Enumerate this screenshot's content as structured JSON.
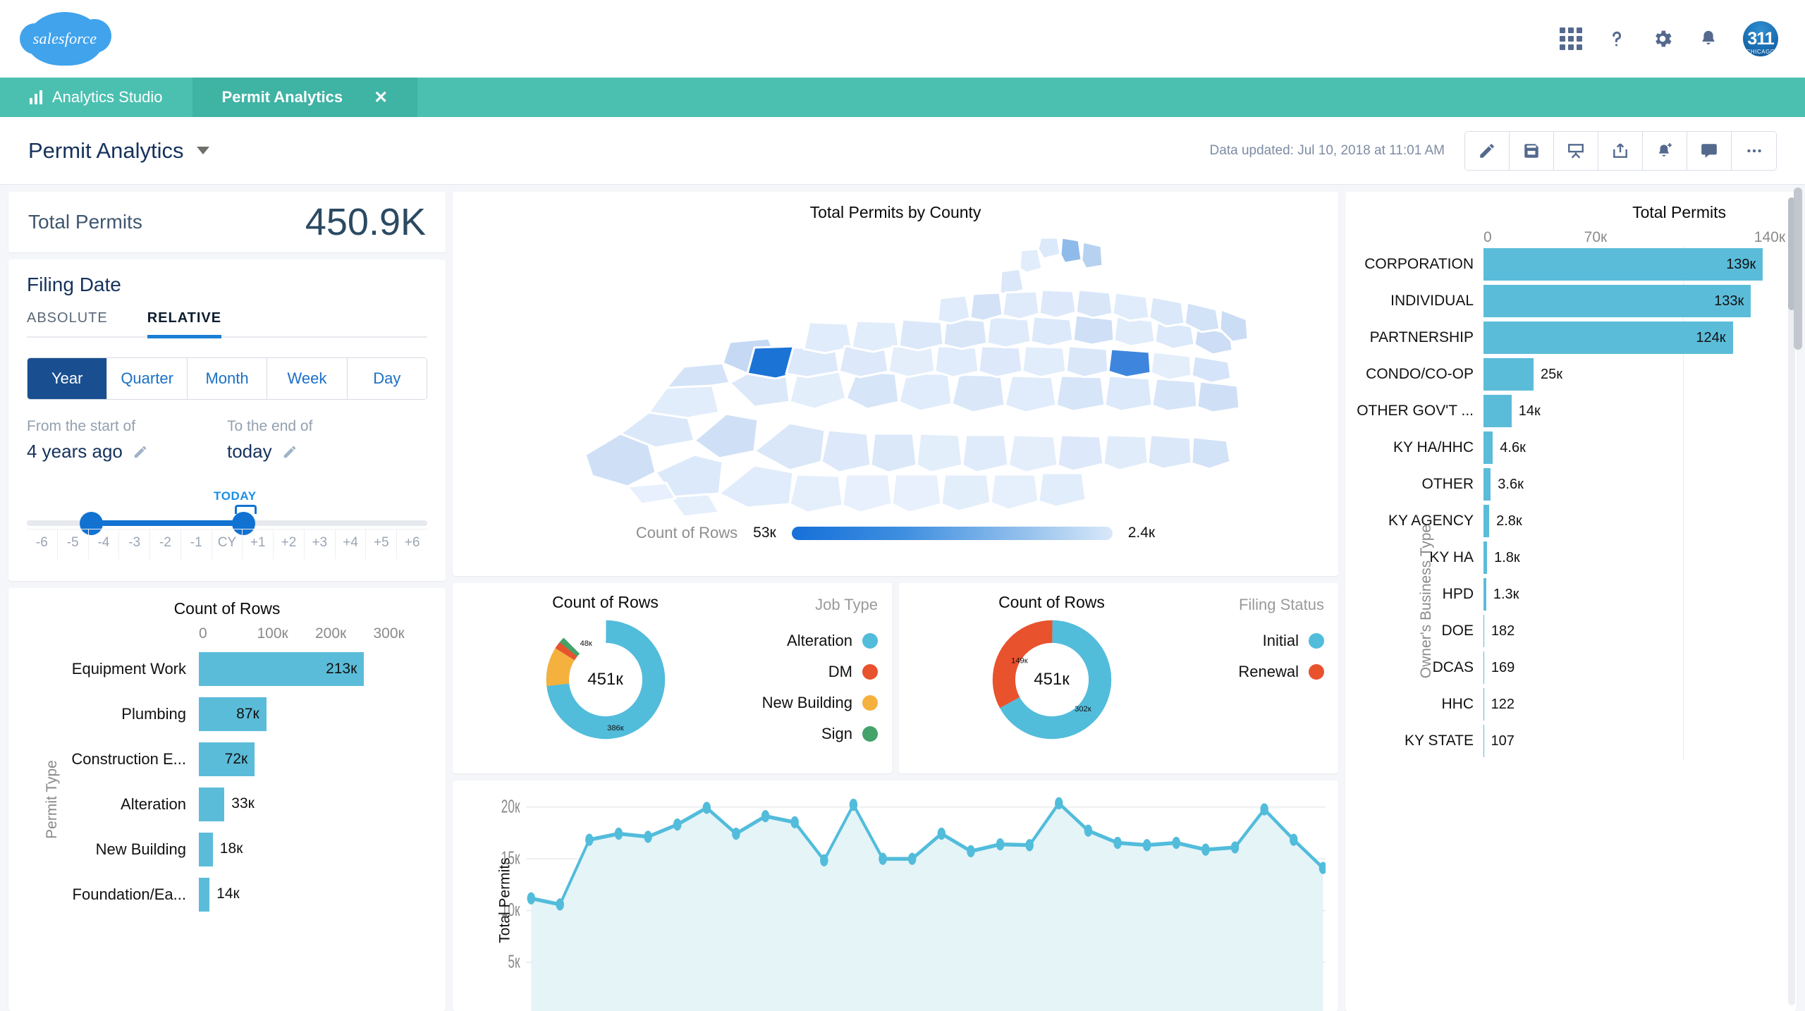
{
  "header": {
    "logo_text": "salesforce",
    "icons": [
      "app-launcher-icon",
      "help-icon",
      "gear-icon",
      "bell-icon"
    ],
    "avatar_text": "311",
    "avatar_sub": "CHICAGO"
  },
  "tabs": [
    {
      "label": "Analytics Studio",
      "icon": "bar-chart-icon",
      "active": false
    },
    {
      "label": "Permit Analytics",
      "icon": "",
      "active": true,
      "closable": true
    }
  ],
  "toolbar": {
    "title": "Permit Analytics",
    "data_updated": "Data updated: Jul 10, 2018 at 11:01 AM",
    "buttons": [
      "edit-pencil",
      "save-disk",
      "present",
      "share",
      "notify-add",
      "comment",
      "more"
    ]
  },
  "kpi": {
    "label": "Total Permits",
    "value": "450.9K"
  },
  "filing_date": {
    "title": "Filing Date",
    "tabs": [
      {
        "label": "ABSOLUTE",
        "active": false
      },
      {
        "label": "RELATIVE",
        "active": true
      }
    ],
    "segments": [
      {
        "label": "Year",
        "active": true
      },
      {
        "label": "Quarter",
        "active": false
      },
      {
        "label": "Month",
        "active": false
      },
      {
        "label": "Week",
        "active": false
      },
      {
        "label": "Day",
        "active": false
      }
    ],
    "from_label": "From the start of",
    "from_value": "4 years ago",
    "to_label": "To the end of",
    "to_value": "today",
    "today_marker": "TODAY",
    "ticks": [
      "-6",
      "-5",
      "-4",
      "-3",
      "-2",
      "-1",
      "CY",
      "+1",
      "+2",
      "+3",
      "+4",
      "+5",
      "+6"
    ]
  },
  "chart_data": [
    {
      "id": "permit_type",
      "type": "bar",
      "orientation": "horizontal",
      "title": "Count of Rows",
      "ylabel": "Permit Type",
      "xlabel": "",
      "xticks": [
        "0",
        "100к",
        "200к",
        "300к"
      ],
      "xlim": [
        0,
        300000
      ],
      "categories": [
        "Equipment Work",
        "Plumbing",
        "Construction E...",
        "Alteration",
        "New Building",
        "Foundation/Ea..."
      ],
      "values": [
        213000,
        87000,
        72000,
        33000,
        18000,
        14000
      ],
      "value_labels": [
        "213к",
        "87к",
        "72к",
        "33к",
        "18к",
        "14к"
      ],
      "color": "#5bbcd9"
    },
    {
      "id": "permits_by_county",
      "type": "map",
      "title": "Total Permits by County",
      "legend_label": "Count of Rows",
      "legend_min": "53к",
      "legend_max": "2.4к",
      "color_min": "#1670d8",
      "color_max": "#d9e8f9"
    },
    {
      "id": "job_type",
      "type": "pie",
      "title": "Count of Rows",
      "legend_title": "Job Type",
      "center_label": "451к",
      "categories": [
        "Alteration",
        "DM",
        "New Building",
        "Sign"
      ],
      "values": [
        386000,
        9000,
        48000,
        8000
      ],
      "value_labels": [
        "386к",
        "",
        "48к",
        ""
      ],
      "colors": [
        "#52bcdb",
        "#e8522d",
        "#f5b13d",
        "#43a36a"
      ]
    },
    {
      "id": "filing_status",
      "type": "pie",
      "title": "Count of Rows",
      "legend_title": "Filing Status",
      "center_label": "451к",
      "categories": [
        "Initial",
        "Renewal"
      ],
      "values": [
        302000,
        149000
      ],
      "value_labels": [
        "302к",
        "149к"
      ],
      "colors": [
        "#52bcdb",
        "#e8522d"
      ]
    },
    {
      "id": "permits_over_time",
      "type": "area",
      "title": "",
      "ylabel": "Total Permits",
      "yticks": [
        "20к",
        "15к",
        "10к",
        "5к"
      ],
      "ylim": [
        0,
        21000
      ],
      "line_color": "#52bcdb",
      "fill_color": "#e4f4f7",
      "values": [
        11200,
        10600,
        15800,
        16400,
        16100,
        17300,
        19300,
        16800,
        18500,
        17900,
        13600,
        19600,
        13700,
        13700,
        16400,
        14700,
        15400,
        15300,
        19700,
        16900,
        15500,
        15300,
        15500,
        14800,
        15000,
        19100,
        15700,
        13000
      ]
    },
    {
      "id": "owner_business_type",
      "type": "bar",
      "orientation": "horizontal",
      "title": "Total Permits",
      "ylabel": "Owner's Business Type",
      "xticks": [
        "0",
        "70к",
        "140к"
      ],
      "xlim": [
        0,
        150000
      ],
      "categories": [
        "CORPORATION",
        "INDIVIDUAL",
        "PARTNERSHIP",
        "CONDO/CO-OP",
        "OTHER GOV'T ...",
        "KY HA/HHC",
        "OTHER",
        "KY AGENCY",
        "KY HA",
        "HPD",
        "DOE",
        "DCAS",
        "HHC",
        "KY STATE"
      ],
      "values": [
        139000,
        133000,
        124000,
        25000,
        14000,
        4600,
        3600,
        2800,
        1800,
        1300,
        182,
        169,
        122,
        107
      ],
      "value_labels": [
        "139к",
        "133к",
        "124к",
        "25к",
        "14к",
        "4.6к",
        "3.6к",
        "2.8к",
        "1.8к",
        "1.3к",
        "182",
        "169",
        "122",
        "107"
      ],
      "color": "#5bbcd9"
    }
  ]
}
